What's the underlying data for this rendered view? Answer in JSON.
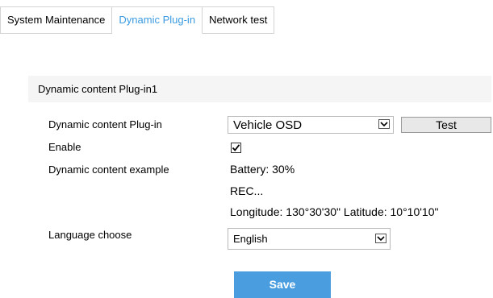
{
  "tabs": [
    {
      "label": "System Maintenance",
      "active": false
    },
    {
      "label": "Dynamic Plug-in",
      "active": true
    },
    {
      "label": "Network test",
      "active": false
    }
  ],
  "panel": {
    "title": "Dynamic content Plug-in1"
  },
  "form": {
    "plugin_label": "Dynamic content Plug-in",
    "plugin_select_value": "Vehicle OSD",
    "test_button": "Test",
    "enable_label": "Enable",
    "enable_checked": true,
    "example_label": "Dynamic content example",
    "example_lines": [
      "Battery: 30%",
      "REC...",
      "Longitude: 130°30'30\" Latitude: 10°10'10\""
    ],
    "language_label": "Language choose",
    "language_select_value": "English",
    "save_button": "Save"
  },
  "colors": {
    "active_tab": "#3a9be0",
    "save_button_bg": "#4a9ee0",
    "panel_header_bg": "#f5f5f5"
  }
}
